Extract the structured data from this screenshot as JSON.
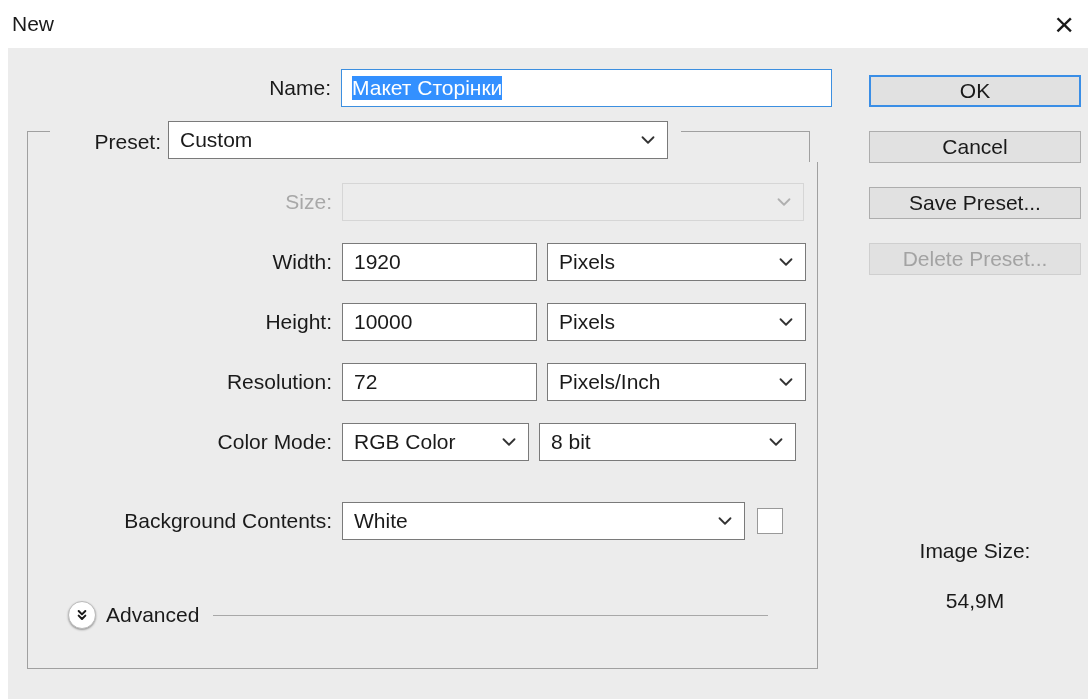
{
  "window": {
    "title": "New",
    "close": "×"
  },
  "name": {
    "label": "Name:",
    "value": "Макет Сторінки",
    "selected": true,
    "focused": true
  },
  "preset": {
    "label": "Preset:",
    "value": "Custom"
  },
  "rows": [
    {
      "kind": "disabled",
      "label": "Size:"
    },
    {
      "kind": "number",
      "label": "Width:",
      "value": "1920",
      "unit": "Pixels"
    },
    {
      "kind": "number",
      "label": "Height:",
      "value": "10000",
      "unit": "Pixels"
    },
    {
      "kind": "number",
      "label": "Resolution:",
      "value": "72",
      "unit": "Pixels/Inch"
    },
    {
      "kind": "pair",
      "label": "Color Mode:",
      "value": "RGB Color",
      "unit": "8 bit"
    },
    {
      "kind": "swatch",
      "label": "Background Contents:",
      "value": "White"
    }
  ],
  "advanced": {
    "label": "Advanced",
    "expanded": false
  },
  "buttons": [
    {
      "label": "OK",
      "default": true,
      "disabled": false
    },
    {
      "label": "Cancel",
      "default": false,
      "disabled": false
    },
    {
      "label": "Save Preset...",
      "default": false,
      "disabled": false
    },
    {
      "label": "Delete Preset...",
      "default": false,
      "disabled": true
    }
  ],
  "image_size": {
    "label": "Image Size:",
    "value": "54,9M"
  }
}
